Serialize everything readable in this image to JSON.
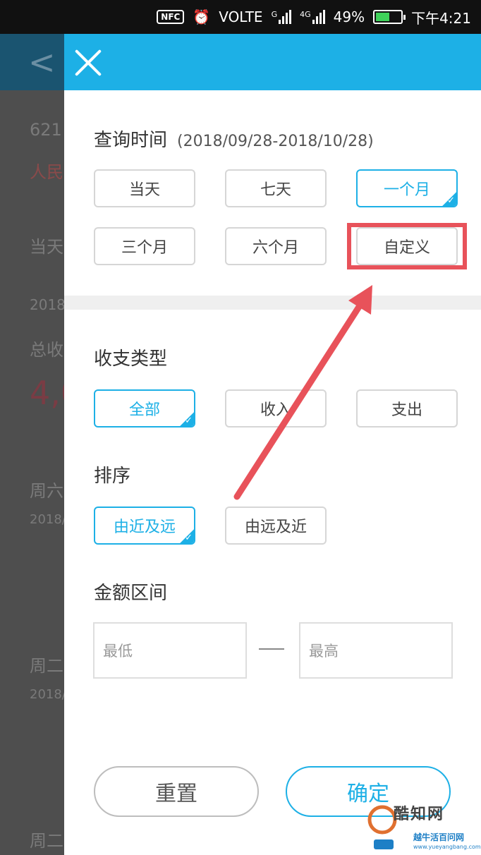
{
  "status_bar": {
    "nfc": "NFC",
    "alarm_icon": "alarm-clock-icon",
    "network": "VOLTE",
    "signal_1": "G",
    "signal_2": "4G",
    "battery": "49%",
    "time": "下午4:21"
  },
  "background_page": {
    "lines": [
      "621",
      "人民",
      "当天",
      "2018",
      "总收",
      "4,0",
      "周六",
      "2018/",
      "周二",
      "2018/",
      "周二"
    ]
  },
  "drawer": {
    "close_icon": "close-icon",
    "query_time": {
      "title": "查询时间",
      "range": "(2018/09/28-2018/10/28)",
      "options": [
        "当天",
        "七天",
        "一个月",
        "三个月",
        "六个月",
        "自定义"
      ],
      "selected": "一个月"
    },
    "income_type": {
      "title": "收支类型",
      "options": [
        "全部",
        "收入",
        "支出"
      ],
      "selected": "全部"
    },
    "sort": {
      "title": "排序",
      "options": [
        "由近及远",
        "由远及近"
      ],
      "selected": "由近及远"
    },
    "amount": {
      "title": "金额区间",
      "min_placeholder": "最低",
      "max_placeholder": "最高",
      "separator": "—"
    },
    "reset_label": "重置",
    "confirm_label": "确定"
  },
  "watermark": {
    "name": "酷知网",
    "sub": "越牛活百问网",
    "url": "www.yueyangbang.com"
  },
  "colors": {
    "accent": "#1db0e6",
    "annotation": "#e8525a"
  }
}
